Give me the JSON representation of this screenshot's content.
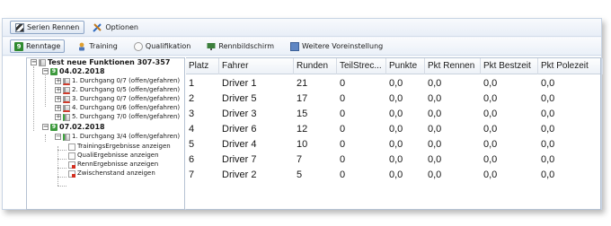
{
  "menu": {
    "tabs": [
      {
        "label": "Serien Rennen",
        "icon": "flag-icon",
        "active": true
      },
      {
        "label": "Optionen",
        "icon": "tools-icon",
        "active": false
      }
    ]
  },
  "toolbar": {
    "buttons": [
      {
        "label": "Renntage",
        "icon": "calendar-9-icon",
        "active": true
      },
      {
        "label": "Training",
        "icon": "driver-icon",
        "active": false
      },
      {
        "label": "Qualifikation",
        "icon": "stopwatch-icon",
        "active": false
      },
      {
        "label": "Rennbildschirm",
        "icon": "race-screen-icon",
        "active": false
      },
      {
        "label": "Weitere Voreinstellung",
        "icon": "settings-icon",
        "active": false
      }
    ]
  },
  "tree": {
    "root": "Test neue Funktionen 307-357",
    "dates": [
      {
        "label": "04.02.2018",
        "items": [
          "1. Durchgang 0/7 (offen/gefahren)",
          "2. Durchgang 0/5 (offen/gefahren)",
          "3. Durchgang 0/7 (offen/gefahren)",
          "4. Durchgang 0/6 (offen/gefahren)",
          "5. Durchgang 7/0 (offen/gefahren)"
        ]
      },
      {
        "label": "07.02.2018",
        "items": [
          "1. Durchgang 3/4 (offen/gefahren)"
        ],
        "subitems": [
          "TrainingsErgebnisse anzeigen",
          "QualiErgebnisse anzeigen",
          "RennErgebnisse anzeigen",
          "Zwischenstand anzeigen"
        ]
      }
    ]
  },
  "table": {
    "columns": [
      "Platz",
      "Fahrer",
      "Runden",
      "TeilStrec...",
      "Punkte",
      "Pkt Rennen",
      "Pkt Bestzeit",
      "Pkt Polezeit"
    ],
    "rows": [
      [
        "1",
        "Driver 1",
        "21",
        "0",
        "0,0",
        "0,0",
        "0,0",
        "0,0"
      ],
      [
        "2",
        "Driver 5",
        "17",
        "0",
        "0,0",
        "0,0",
        "0,0",
        "0,0"
      ],
      [
        "3",
        "Driver 3",
        "15",
        "0",
        "0,0",
        "0,0",
        "0,0",
        "0,0"
      ],
      [
        "4",
        "Driver 6",
        "12",
        "0",
        "0,0",
        "0,0",
        "0,0",
        "0,0"
      ],
      [
        "5",
        "Driver 4",
        "10",
        "0",
        "0,0",
        "0,0",
        "0,0",
        "0,0"
      ],
      [
        "6",
        "Driver 7",
        "7",
        "0",
        "0,0",
        "0,0",
        "0,0",
        "0,0"
      ],
      [
        "7",
        "Driver 2",
        "5",
        "0",
        "0,0",
        "0,0",
        "0,0",
        "0,0"
      ]
    ]
  }
}
